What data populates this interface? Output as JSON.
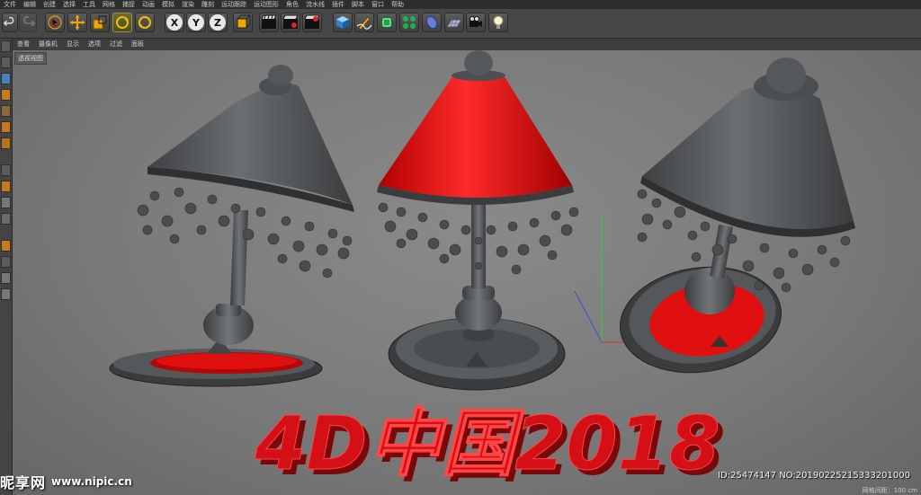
{
  "menubar": {
    "items": [
      "文件",
      "编辑",
      "创建",
      "选择",
      "工具",
      "网格",
      "捕捉",
      "动画",
      "模拟",
      "渲染",
      "雕刻",
      "运动跟踪",
      "运动图形",
      "角色",
      "流水线",
      "插件",
      "脚本",
      "窗口",
      "帮助"
    ]
  },
  "toolbar": {
    "axis_x": "X",
    "axis_y": "Y",
    "axis_z": "Z",
    "icons": [
      "undo-icon",
      "redo-icon",
      "select-arrow-icon",
      "move-icon",
      "scale-icon",
      "rotate-icon",
      "rotate-alt-icon",
      "x-axis-icon",
      "y-axis-icon",
      "z-axis-icon",
      "coordinate-system-icon",
      "render-view-icon",
      "render-picture-icon",
      "render-settings-icon",
      "cube-icon",
      "pen-icon",
      "subdivision-icon",
      "array-icon",
      "deformer-icon",
      "floor-icon",
      "camera-icon",
      "light-icon"
    ]
  },
  "viewport_menu": {
    "items": [
      "查看",
      "摄像机",
      "显示",
      "选项",
      "过滤",
      "面板"
    ]
  },
  "viewport": {
    "label": "透视视图",
    "status": "网格间距：100 cm",
    "axis_label": "y"
  },
  "scene": {
    "headline": "4D中国2018",
    "colors": {
      "lamp_grey": "#505356",
      "shade_red": "#e01010",
      "text_red": "#d40f16"
    }
  },
  "watermark": {
    "logo": "昵享网",
    "url": "www.nipic.cn",
    "id": "ID:25474147 NO:20190225215333201000"
  }
}
